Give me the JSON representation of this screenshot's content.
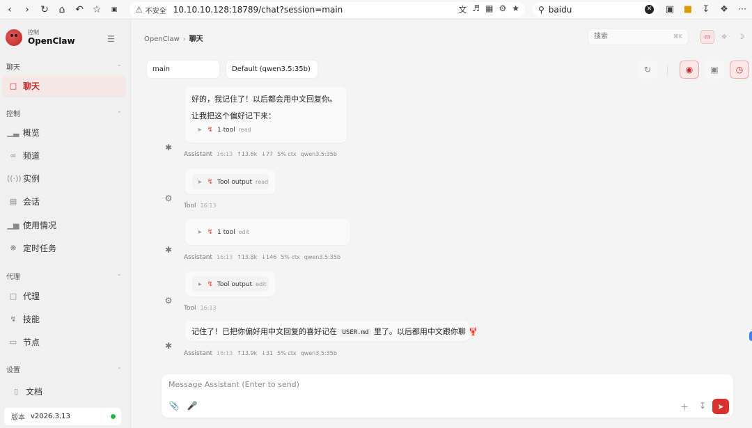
{
  "browser": {
    "url_warning": "不安全",
    "url": "10.10.10.128:18789/chat?session=main",
    "search_query": "baidu"
  },
  "sidebar": {
    "brand_sub": "控制",
    "brand_name": "OpenClaw",
    "sections": {
      "chat": "聊天",
      "control": "控制",
      "agent": "代理",
      "settings": "设置"
    },
    "items": {
      "chat": "聊天",
      "overview": "概览",
      "channels": "频道",
      "instances": "实例",
      "sessions": "会话",
      "usage": "使用情况",
      "cron": "定时任务",
      "agents": "代理",
      "skills": "技能",
      "nodes": "节点",
      "docs": "文档"
    },
    "version_label": "版本",
    "version": "v2026.3.13"
  },
  "header": {
    "breadcrumb_root": "OpenClaw",
    "breadcrumb_current": "聊天",
    "search_placeholder": "搜索",
    "search_kbd": "⌘K"
  },
  "controls": {
    "session": "main",
    "model": "Default (qwen3.5:35b)"
  },
  "messages": [
    {
      "line1": "好的，我记住了！以后都会用中文回复你。",
      "line2": "让我把这个偏好记下来：",
      "tool_label": "1 tool",
      "tool_name": "read",
      "role": "Assistant",
      "time": "16:13",
      "tokens_in": "↑13.6k",
      "tokens_out": "↓77",
      "ctx": "5% ctx",
      "model": "qwen3.5:35b"
    },
    {
      "tool_label": "Tool output",
      "tool_name": "read",
      "role": "Tool",
      "time": "16:13"
    },
    {
      "tool_label": "1 tool",
      "tool_name": "edit",
      "role": "Assistant",
      "time": "16:13",
      "tokens_in": "↑13.8k",
      "tokens_out": "↓146",
      "ctx": "5% ctx",
      "model": "qwen3.5:35b"
    },
    {
      "tool_label": "Tool output",
      "tool_name": "edit",
      "role": "Tool",
      "time": "16:13"
    },
    {
      "text_before": "记住了！已把你偏好用中文回复的喜好记在",
      "code": "USER.md",
      "text_after": "里了。以后都用中文跟你聊",
      "emoji": "🦞",
      "role": "Assistant",
      "time": "16:13",
      "tokens_in": "↑13.9k",
      "tokens_out": "↓31",
      "ctx": "5% ctx",
      "model": "qwen3.5:35b"
    }
  ],
  "composer": {
    "placeholder": "Message Assistant (Enter to send)"
  },
  "colors": {
    "accent": "#d9332f",
    "active_bg": "#f7e8e8",
    "status_ok": "#2ab34a"
  }
}
